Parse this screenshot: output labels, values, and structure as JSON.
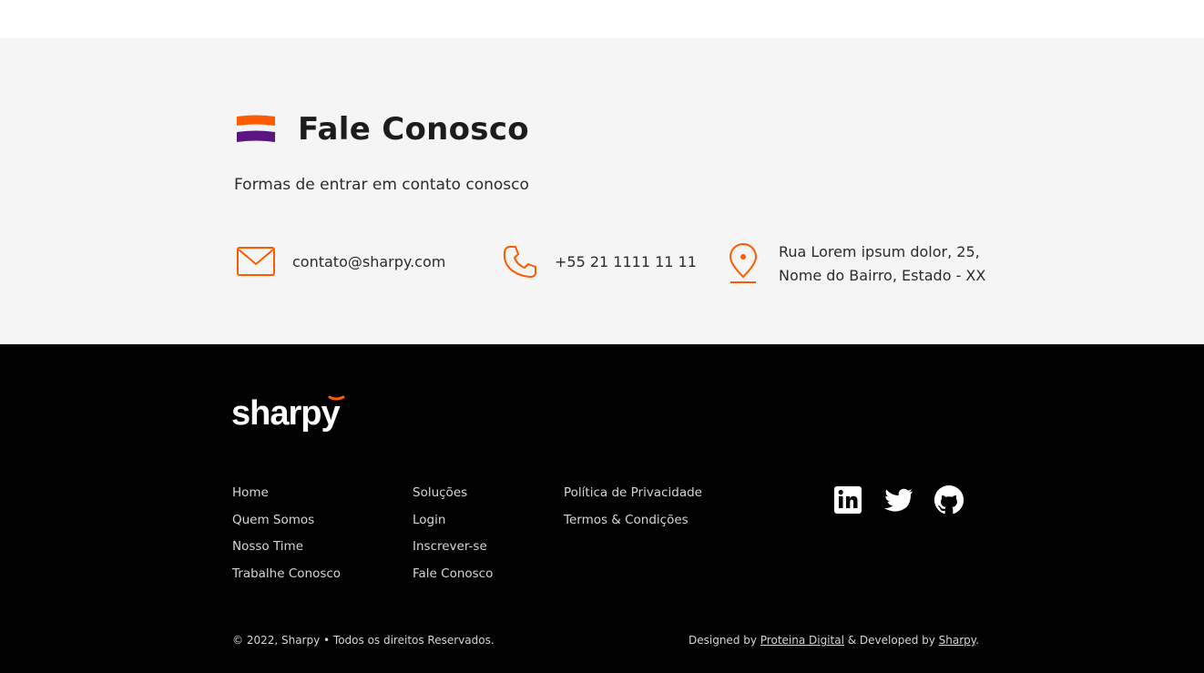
{
  "contact": {
    "title": "Fale Conosco",
    "subtitle": "Formas de entrar em contato conosco",
    "email": "contato@sharpy.com",
    "phone": "+55 21 1111 11 11",
    "address_line1": "Rua Lorem ipsum dolor, 25,",
    "address_line2": "Nome do Bairro, Estado - XX",
    "icons": {
      "email": "mail-icon",
      "phone": "phone-icon",
      "address": "map-pin-icon"
    }
  },
  "footer": {
    "logo_text": "sharpy",
    "columns": [
      [
        "Home",
        "Quem Somos",
        "Nosso Time",
        "Trabalhe Conosco"
      ],
      [
        "Soluções",
        "Login",
        "Inscrever-se",
        "Fale Conosco"
      ],
      [
        "Política de Privacidade",
        "Termos & Condições"
      ]
    ],
    "social": [
      "linkedin-icon",
      "twitter-icon",
      "github-icon"
    ],
    "copyright": "© 2022, Sharpy • Todos os direitos Reservados.",
    "designed_by_prefix": "Designed by ",
    "designer": "Proteina Digital",
    "developed_by_prefix": " & Developed by ",
    "developer": "Sharpy",
    "suffix": "."
  },
  "colors": {
    "accent_orange": "#ff5a00",
    "accent_purple": "#5b1580",
    "footer_bg": "#000000",
    "section_bg": "#f5f5f5"
  }
}
